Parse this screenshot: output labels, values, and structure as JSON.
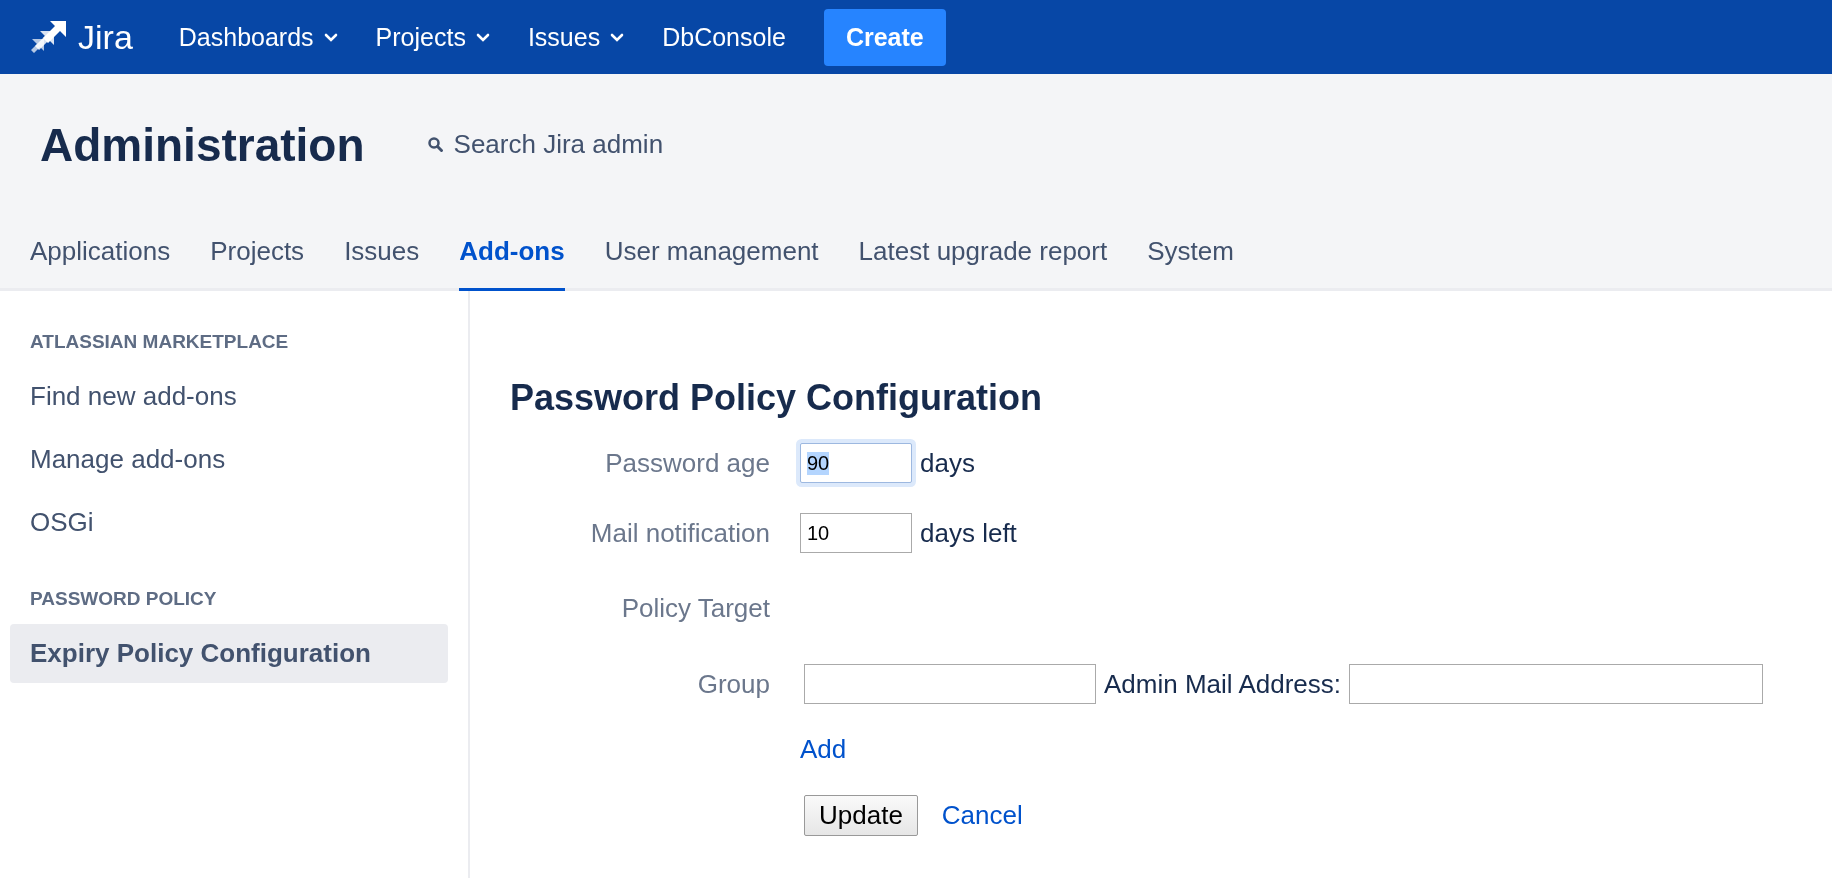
{
  "topbar": {
    "logo": "Jira",
    "nav": [
      {
        "label": "Dashboards",
        "dropdown": true
      },
      {
        "label": "Projects",
        "dropdown": true
      },
      {
        "label": "Issues",
        "dropdown": true
      },
      {
        "label": "DbConsole",
        "dropdown": false
      }
    ],
    "create": "Create"
  },
  "header": {
    "title": "Administration",
    "search": "Search Jira admin"
  },
  "tabs": [
    {
      "label": "Applications",
      "selected": false
    },
    {
      "label": "Projects",
      "selected": false
    },
    {
      "label": "Issues",
      "selected": false
    },
    {
      "label": "Add-ons",
      "selected": true
    },
    {
      "label": "User management",
      "selected": false
    },
    {
      "label": "Latest upgrade report",
      "selected": false
    },
    {
      "label": "System",
      "selected": false
    }
  ],
  "sidebar": {
    "sections": [
      {
        "title": "ATLASSIAN MARKETPLACE",
        "items": [
          {
            "label": "Find new add-ons",
            "selected": false
          },
          {
            "label": "Manage add-ons",
            "selected": false
          },
          {
            "label": "OSGi",
            "selected": false
          }
        ]
      },
      {
        "title": "PASSWORD POLICY",
        "items": [
          {
            "label": "Expiry Policy Configuration",
            "selected": true
          }
        ]
      }
    ]
  },
  "form": {
    "title": "Password Policy Configuration",
    "password_age": {
      "label": "Password age",
      "value": "90",
      "focused": true,
      "unit": "days"
    },
    "mail_notification": {
      "label": "Mail notification",
      "value": "10",
      "focused": false,
      "unit": "days left"
    },
    "policy_target": {
      "label": "Policy Target"
    },
    "group": {
      "label": "Group",
      "admin_mail_label": "Admin Mail Address:"
    },
    "add": "Add",
    "update": "Update",
    "cancel": "Cancel"
  }
}
